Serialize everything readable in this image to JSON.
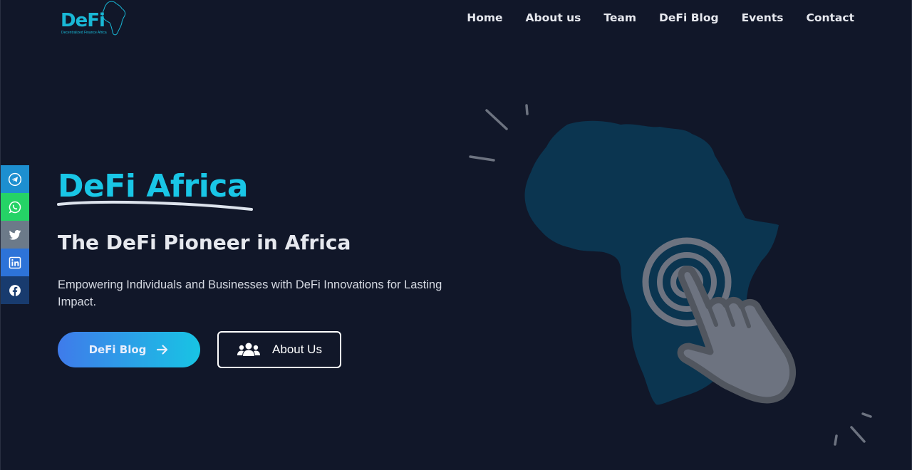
{
  "logo": {
    "mark": "DeFi",
    "subtitle": "Decentralized Finance Africa"
  },
  "nav": {
    "items": [
      {
        "label": "Home"
      },
      {
        "label": "About us"
      },
      {
        "label": "Team"
      },
      {
        "label": "DeFi Blog"
      },
      {
        "label": "Events"
      },
      {
        "label": "Contact"
      }
    ]
  },
  "social": {
    "items": [
      {
        "icon": "telegram-icon",
        "color": "#1d8fd0"
      },
      {
        "icon": "whatsapp-icon",
        "color": "#25d366"
      },
      {
        "icon": "twitter-icon",
        "color": "#6c7a89"
      },
      {
        "icon": "linkedin-icon",
        "color": "#2d73d8"
      },
      {
        "icon": "facebook-icon",
        "color": "#183b6e"
      }
    ]
  },
  "hero": {
    "title": "DeFi Africa",
    "subtitle": "The DeFi Pioneer in Africa",
    "description": "Empowering Individuals and Businesses with DeFi Innovations for Lasting Impact.",
    "primary_button": {
      "label": "DeFi Blog",
      "icon": "arrow-right-icon"
    },
    "secondary_button": {
      "label": "About Us",
      "icon": "users-icon"
    }
  },
  "colors": {
    "background": "#111729",
    "accent": "#19c6e6",
    "map": "#0b3550"
  }
}
